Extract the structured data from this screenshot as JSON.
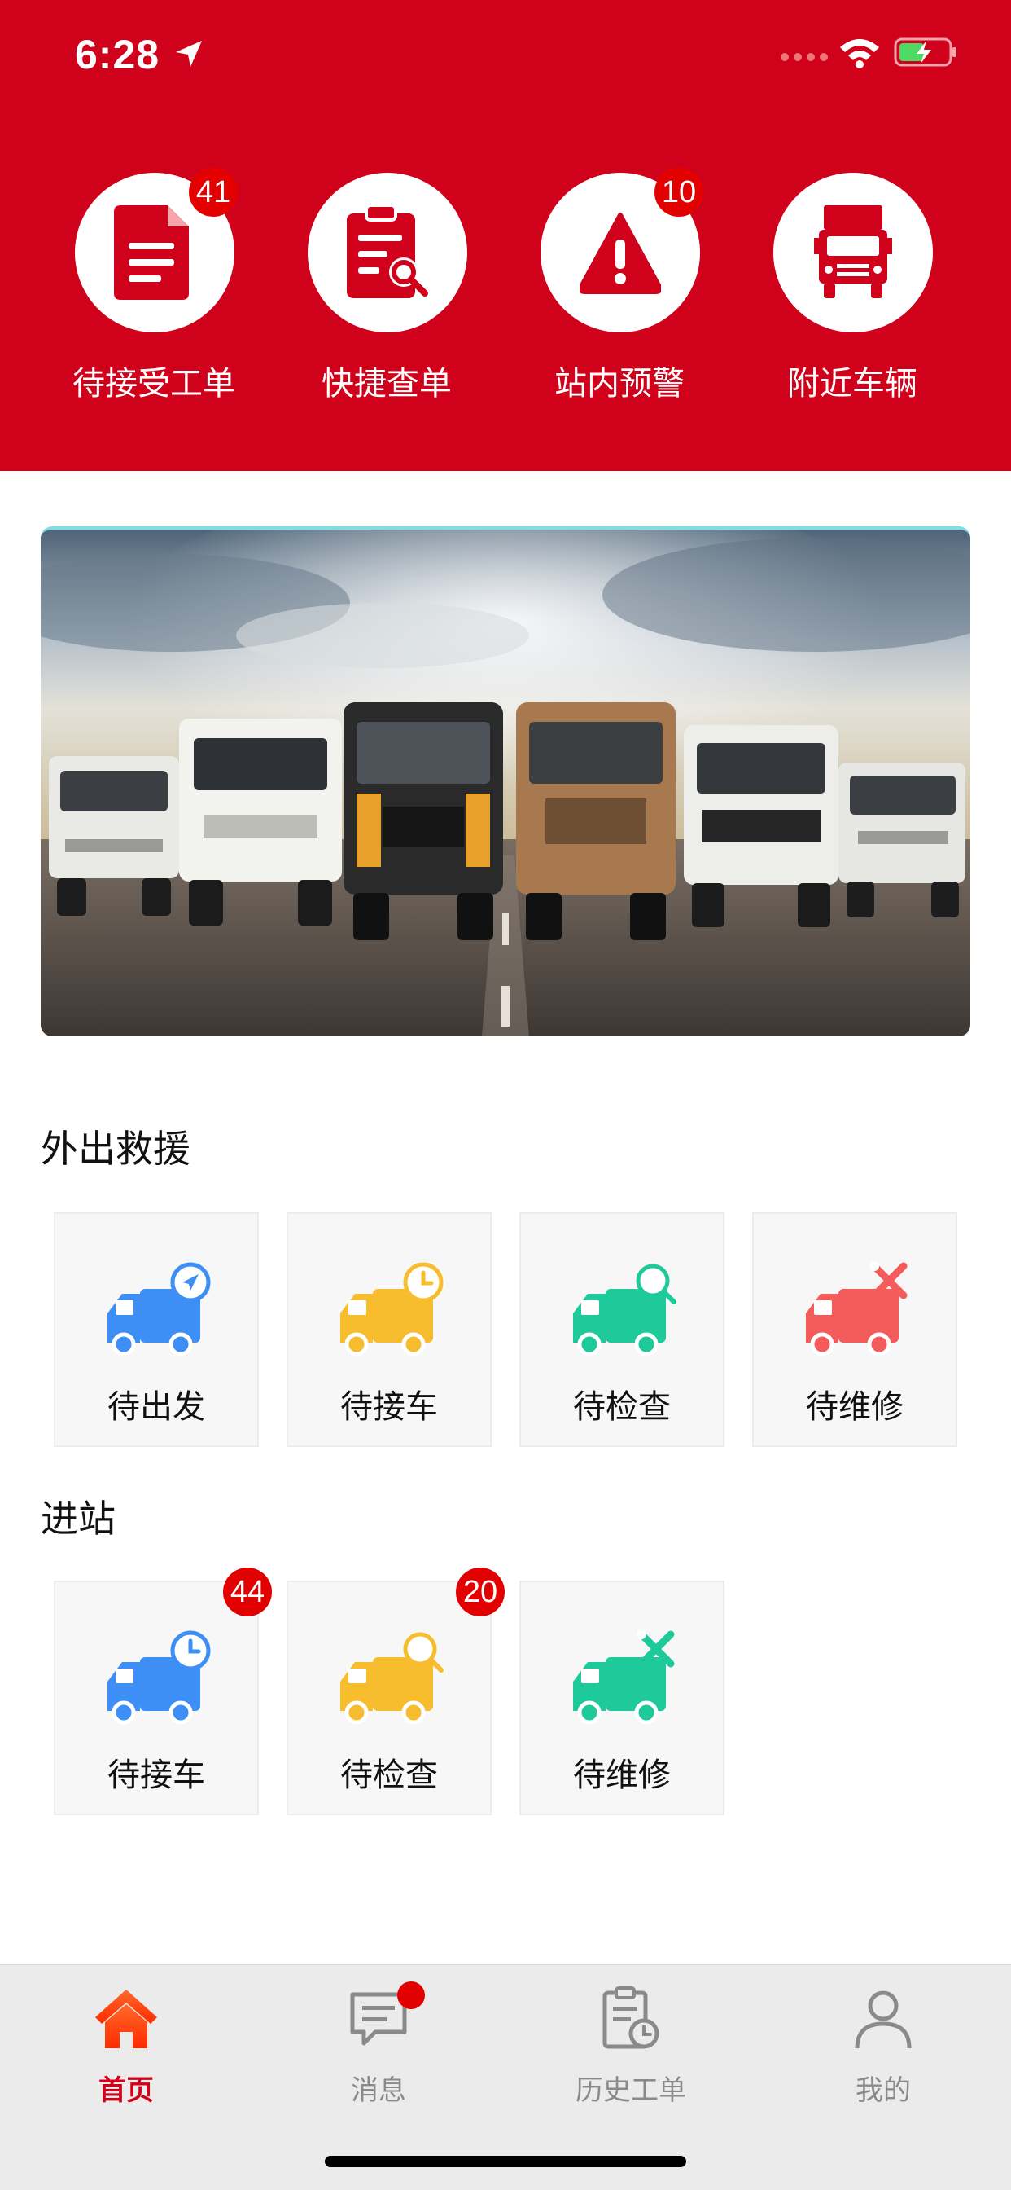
{
  "status_bar": {
    "time": "6:28"
  },
  "quick_actions": [
    {
      "label": "待接受工单",
      "badge": "41",
      "icon": "document-icon"
    },
    {
      "label": "快捷查单",
      "badge": "",
      "icon": "clipboard-search-icon"
    },
    {
      "label": "站内预警",
      "badge": "10",
      "icon": "warning-icon"
    },
    {
      "label": "附近车辆",
      "badge": "",
      "icon": "truck-front-icon"
    }
  ],
  "banner": {
    "image": "trucks-lineup-banner"
  },
  "rescue_section": {
    "title": "外出救援",
    "items": [
      {
        "label": "待出发",
        "icon": "truck-send-icon",
        "color": "#3d8ef5"
      },
      {
        "label": "待接车",
        "icon": "truck-clock-icon",
        "color": "#f7bd2e"
      },
      {
        "label": "待检查",
        "icon": "truck-search-icon",
        "color": "#1ec99a"
      },
      {
        "label": "待维修",
        "icon": "truck-repair-icon",
        "color": "#f45b5b"
      }
    ]
  },
  "station_section": {
    "title": "进站",
    "items": [
      {
        "label": "待接车",
        "badge": "44",
        "icon": "truck-clock-icon",
        "color": "#3d8ef5"
      },
      {
        "label": "待检查",
        "badge": "20",
        "icon": "truck-search-icon",
        "color": "#f7bd2e"
      },
      {
        "label": "待维修",
        "badge": "",
        "icon": "truck-repair-icon",
        "color": "#1ec99a"
      }
    ]
  },
  "tab_bar": {
    "items": [
      {
        "label": "首页",
        "icon": "home-icon",
        "active": true
      },
      {
        "label": "消息",
        "icon": "message-icon",
        "active": false
      },
      {
        "label": "历史工单",
        "icon": "history-order-icon",
        "active": false
      },
      {
        "label": "我的",
        "icon": "user-icon",
        "active": false
      }
    ]
  },
  "colors": {
    "brand_red": "#d0021b",
    "badge_red": "#e30000",
    "tab_inactive": "#8a8a8a"
  }
}
